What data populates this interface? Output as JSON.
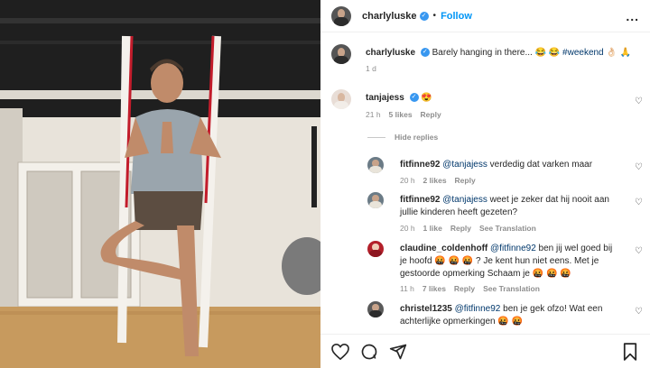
{
  "header": {
    "username": "charlyluske",
    "separator": "•",
    "follow_label": "Follow",
    "more_label": "..."
  },
  "caption": {
    "username": "charlyluske",
    "text": "Barely hanging in there... 😂 😂",
    "hashtag": "#weekend",
    "emoji_tail": "👌🏻 🙏",
    "time": "1 d"
  },
  "comments": [
    {
      "username": "tanjajess",
      "verified": true,
      "text": "😍",
      "time": "21 h",
      "likes": "5 likes",
      "reply": "Reply"
    }
  ],
  "hide_replies_label": "Hide replies",
  "replies": [
    {
      "username": "fitfinne92",
      "mention": "@tanjajess",
      "text": "verdedig dat varken maar",
      "time": "20 h",
      "likes": "2 likes",
      "reply": "Reply"
    },
    {
      "username": "fitfinne92",
      "mention": "@tanjajess",
      "text": "weet je zeker dat hij nooit aan",
      "text2": "jullie kinderen heeft gezeten?",
      "time": "20 h",
      "likes": "1 like",
      "reply": "Reply",
      "translation": "See Translation"
    },
    {
      "username": "claudine_coldenhoff",
      "mention": "@fitfinne92",
      "text": "ben jij wel goed bij",
      "text2": "je hoofd 🤬 🤬 🤬 ? Je kent hun niet eens. Met je",
      "text3": "gestoorde opmerking Schaam je 🤬 🤬 🤬",
      "time": "11 h",
      "likes": "7 likes",
      "reply": "Reply",
      "translation": "See Translation"
    },
    {
      "username": "christel1235",
      "mention": "@fitfinne92",
      "text": "ben je gek ofzo! Wat een",
      "text2": "achterlijke opmerkingen 🤬 🤬"
    }
  ],
  "colors": {
    "link": "#0095f6",
    "mention": "#00376b",
    "muted": "#8e8e8e"
  }
}
